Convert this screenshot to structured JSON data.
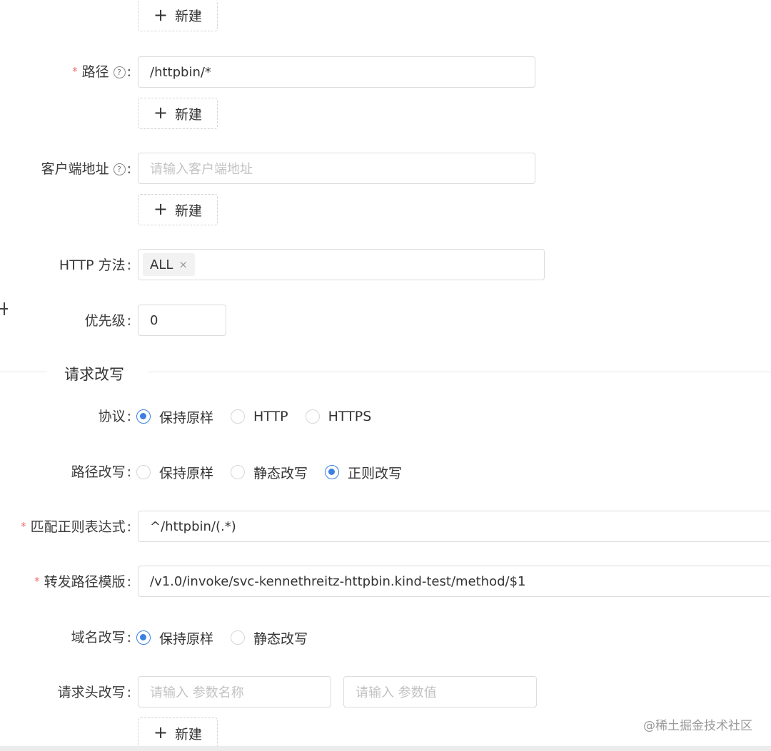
{
  "form": {
    "add_label": "新建",
    "colon": ":",
    "path": {
      "label": "路径",
      "value": "/httpbin/*"
    },
    "client_addr": {
      "label": "客户端地址",
      "placeholder": "请输入客户端地址"
    },
    "http_method": {
      "label": "HTTP 方法",
      "tags": [
        "ALL"
      ],
      "remove_glyph": "×"
    },
    "priority": {
      "label": "优先级",
      "value": "0"
    }
  },
  "rewrite": {
    "section_title": "请求改写",
    "protocol": {
      "label": "协议",
      "options": [
        "保持原样",
        "HTTP",
        "HTTPS"
      ],
      "selected": "保持原样"
    },
    "path_rewrite": {
      "label": "路径改写",
      "options": [
        "保持原样",
        "静态改写",
        "正则改写"
      ],
      "selected": "正则改写"
    },
    "regex": {
      "label": "匹配正则表达式",
      "value": "^/httpbin/(.*)"
    },
    "template": {
      "label": "转发路径模版",
      "value": "/v1.0/invoke/svc-kennethreitz-httpbin.kind-test/method/$1"
    },
    "host_rewrite": {
      "label": "域名改写",
      "options": [
        "保持原样",
        "静态改写"
      ],
      "selected": "保持原样"
    },
    "header_rewrite": {
      "label": "请求头改写",
      "name_placeholder": "请输入 参数名称",
      "value_placeholder": "请输入 参数值"
    }
  },
  "watermark": "@稀土掘金技术社区",
  "colors": {
    "primary": "#3b7fe0",
    "required": "#f26d6d",
    "border": "#dcdcdc",
    "placeholder": "#c2c2c2"
  },
  "icons": {
    "help": "question-circle-icon",
    "add": "plus-icon",
    "tag_close": "close-icon"
  }
}
